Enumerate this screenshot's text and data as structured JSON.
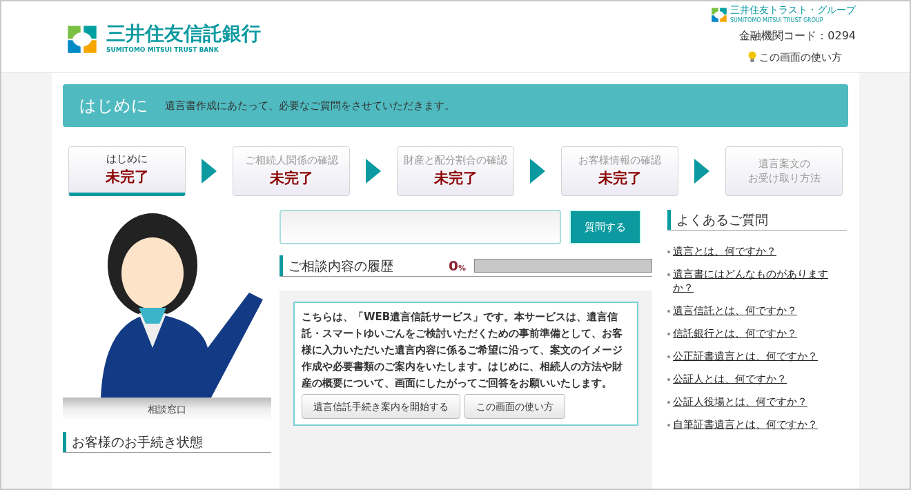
{
  "header": {
    "bank_name": "三井住友信託銀行",
    "bank_name_en": "SUMITOMO MITSUI TRUST BANK",
    "group_name": "三井住友トラスト・グループ",
    "group_name_en": "SUMITOMO MITSUI TRUST GROUP",
    "institution_code": "金融機関コード：0294",
    "help_link": "この画面の使い方"
  },
  "banner": {
    "title": "はじめに",
    "subtitle": "遺言書作成にあたって、必要なご質問をさせていただきます。"
  },
  "steps": [
    {
      "label": "はじめに",
      "status": "未完了",
      "selected": true
    },
    {
      "label": "ご相続人関係の確認",
      "status": "未完了",
      "selected": false
    },
    {
      "label": "財産と配分割合の確認",
      "status": "未完了",
      "selected": false
    },
    {
      "label": "お客様情報の確認",
      "status": "未完了",
      "selected": false
    },
    {
      "label": [
        "遺言案文の",
        "お受け取り方法"
      ],
      "selected": false
    }
  ],
  "assistant": {
    "caption": "相談窓口"
  },
  "procedure_status": {
    "title": "お客様のお手続き状態"
  },
  "question": {
    "button": "質問する"
  },
  "history": {
    "title": "ご相談内容の履歴",
    "percent": "0",
    "unit": "%",
    "level": 0
  },
  "message": {
    "text": "こちらは、「WEB遺言信託サービス」です。本サービスは、遺言信託・スマートゆいごんをご検討いただくための事前準備として、お客様に入力いただいた遺言内容に係るご希望に沿って、案文のイメージ作成や必要書類のご案内をいたします。はじめに、相続人の方法や財産の概要について、画面にしたがってご回答をお願いいたします。",
    "buttons": [
      "遺言信託手続き案内を開始する",
      "この画面の使い方"
    ]
  },
  "faq": {
    "title": "よくあるご質問",
    "items": [
      "遺言とは、何ですか？",
      "遺言書にはどんなものがありますか？",
      "遺言信託とは、何ですか？",
      "信託銀行とは、何ですか？",
      "公正証書遺言とは、何ですか？",
      "公証人とは、何ですか？",
      "公証人役場とは、何ですか？",
      "自筆証書遺言とは、何ですか？"
    ]
  }
}
